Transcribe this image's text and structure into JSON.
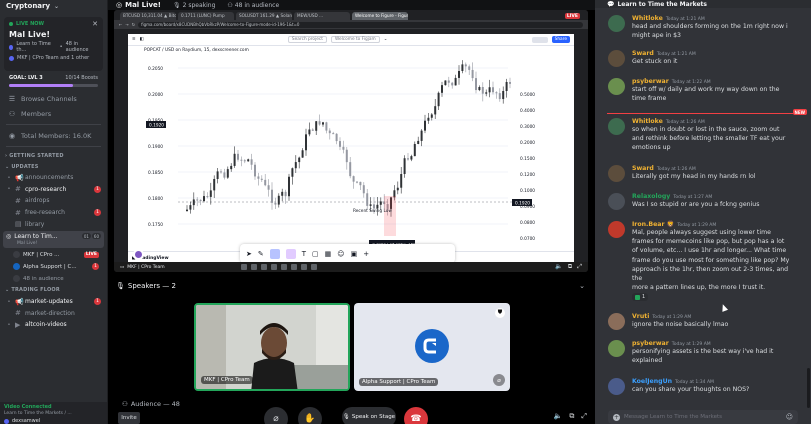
{
  "server": {
    "name": "Cryptonary"
  },
  "live_card": {
    "tag": "LIVE NOW",
    "title": "Mal Live!",
    "channel": "Learn to Time th...",
    "audience": "48 in audience",
    "hosts": "MKF | CPro Team and 1 other"
  },
  "goal": {
    "label": "GOAL: LVL 3",
    "boosts": "10/14 Boosts",
    "progress": 0.714,
    "color": "#b17ff7"
  },
  "nav": [
    {
      "icon": "browse-channels-icon",
      "glyph": "☰",
      "label": "Browse Channels"
    },
    {
      "icon": "members-icon",
      "glyph": "👥",
      "label": "Members"
    },
    {
      "icon": "total-members-icon",
      "glyph": "◉",
      "label": "Total Members: 16.0K"
    }
  ],
  "categories": {
    "getting_started": "GETTING STARTED",
    "updates": "UPDATES",
    "trading_floor": "TRADING FLOOR"
  },
  "update_channels": [
    {
      "label": "announcements",
      "bright": false,
      "badge": ""
    },
    {
      "label": "cpro-research",
      "bright": true,
      "badge": "1"
    },
    {
      "label": "airdrops",
      "bright": false,
      "badge": ""
    },
    {
      "label": "free-research",
      "bright": false,
      "badge": "1"
    },
    {
      "label": "library",
      "bright": false,
      "badge": ""
    }
  ],
  "stage_channel": {
    "label": "Learn to Tim...",
    "sub": "Mal Live!",
    "count_a": "01",
    "count_b": "60"
  },
  "speakers_list": [
    {
      "name": "MKF | CPro ...",
      "live": "LIVE"
    },
    {
      "name": "Alpha Support | C...",
      "badge": "1"
    },
    {
      "name": "48 in audience"
    }
  ],
  "trading_channels": [
    {
      "label": "market-updates",
      "bright": true,
      "badge": "1"
    },
    {
      "label": "market-direction",
      "bright": false,
      "badge": ""
    },
    {
      "label": "altcoin-videos",
      "bright": true,
      "badge": ""
    }
  ],
  "voice": {
    "status": "Video Connected",
    "channel": "Learn to Time the Markets / ...",
    "user": "dexsamwel"
  },
  "stage": {
    "title": "Mal Live!",
    "speaking": "2 speaking",
    "audience": "48 in audience",
    "speakers_heading": "Speakers — 2",
    "audience_heading": "Audience — 48",
    "invite": "Invite",
    "speak_btn": "Speak on Stage",
    "share_live": "LIVE"
  },
  "browser": {
    "tabs": [
      "BTCUSD 10,311.04 ▲ Bitcoin",
      "0.1711 (LUNC) Pump",
      "SOLUSDT 161.29 ▲ Solana",
      "MEW/USD ...",
      "Welcome to Figure - Figure"
    ],
    "url": "figma.com/board/x8CUDNBhQbVbRkzP/Welcome-to-Figure-mode-id-196-1&t=0"
  },
  "tradingview": {
    "symbol": "POPCAT / USD on Raydium, 15, dexscreener.com",
    "search_placeholder": "Search project",
    "welcome_tab": "Welcome to Figjam",
    "share_btn": "Share",
    "brand": "TradingView",
    "support_label": "Recent Swing Low",
    "price_box": "-0.1903 (-16.10%) -1694",
    "price_tag_left": "0.1920",
    "price_tag_right": "0.1920",
    "y_ticks": [
      "0.2050",
      "0.2000",
      "0.1950",
      "0.1900",
      "0.1850",
      "0.1800",
      "0.1750"
    ],
    "right_ticks": [
      "0.5000",
      "0.4000",
      "0.3000",
      "0.2000",
      "0.1500",
      "0.1200",
      "0.1000",
      "0.0900",
      "0.0800",
      "0.0700",
      "0.0600"
    ]
  },
  "taskbar": {
    "streamer": "MKF | CPro Team"
  },
  "tiles": [
    {
      "name": "MKF | CPro Team"
    },
    {
      "name": "Alpha Support | CPro Team"
    }
  ],
  "chat": {
    "channel": "Learn to Time the Markets",
    "new_label": "NEW",
    "input_placeholder": "Message Learn to Time the Markets",
    "messages": [
      {
        "author": "Whitloke",
        "color": "#f0b232",
        "avatar": "#3d6b4f",
        "time": "Today at 1:21 AM",
        "lines": [
          "head and shoulders forming on the 1m right now i",
          "might ape in $3"
        ]
      },
      {
        "author": "Sward",
        "color": "#f0b232",
        "avatar": "#5c4d3c",
        "time": "Today at 1:21 AM",
        "lines": [
          "Get stuck on it"
        ]
      },
      {
        "author": "psyberwar",
        "color": "#f0b232",
        "avatar": "#6a8f4e",
        "time": "Today at 1:22 AM",
        "lines": [
          "start off w/ daily and work my way down on the",
          "time frame"
        ]
      },
      {
        "author": "Whitloke",
        "color": "#f0b232",
        "avatar": "#3d6b4f",
        "time": "Today at 1:26 AM",
        "lines": [
          "so when in doubt or lost in the sauce, zoom out",
          "and rethink before letting the smaller TF eat your",
          "emotions up"
        ]
      },
      {
        "author": "Sward",
        "color": "#f0b232",
        "avatar": "#5c4d3c",
        "time": "Today at 1:26 AM",
        "lines": [
          "Literally got my head in my hands rn lol"
        ]
      },
      {
        "author": "Relaxology",
        "color": "#23a55a",
        "avatar": "#4a4f57",
        "time": "Today at 1:27 AM",
        "lines": [
          "Was I so stupid or are you a fckng genius"
        ]
      },
      {
        "author": "Iron.Bear 🦁",
        "color": "#f0b232",
        "avatar": "#c0392b",
        "time": "Today at 1:29 AM",
        "lines": [
          "Mal, people always suggest using lower time",
          "frames for memecoins like pop, but pop has a lot",
          "of volume, etc... I use 1hr and longer... What time",
          "frame do you use most for something like pop? My",
          "approach is the 1hr, then zoom out 2-3 times, and the",
          "more a pattern lines up, the more I trust it."
        ],
        "reaction": "1"
      },
      {
        "author": "Vruti",
        "color": "#f0b232",
        "avatar": "#8a6d5a",
        "time": "Today at 1:29 AM",
        "lines": [
          "ignore the noise basically lmao"
        ]
      },
      {
        "author": "psyberwar",
        "color": "#f0b232",
        "avatar": "#6a8f4e",
        "time": "Today at 1:29 AM",
        "lines": [
          "personifying assets is the best way i've had it",
          "explained"
        ]
      },
      {
        "author": "KoelJengUn",
        "color": "#3ba0ff",
        "avatar": "#4a5b8a",
        "time": "Today at 1:34 AM",
        "lines": [
          "can you share your thoughts on NOS?"
        ]
      }
    ]
  }
}
